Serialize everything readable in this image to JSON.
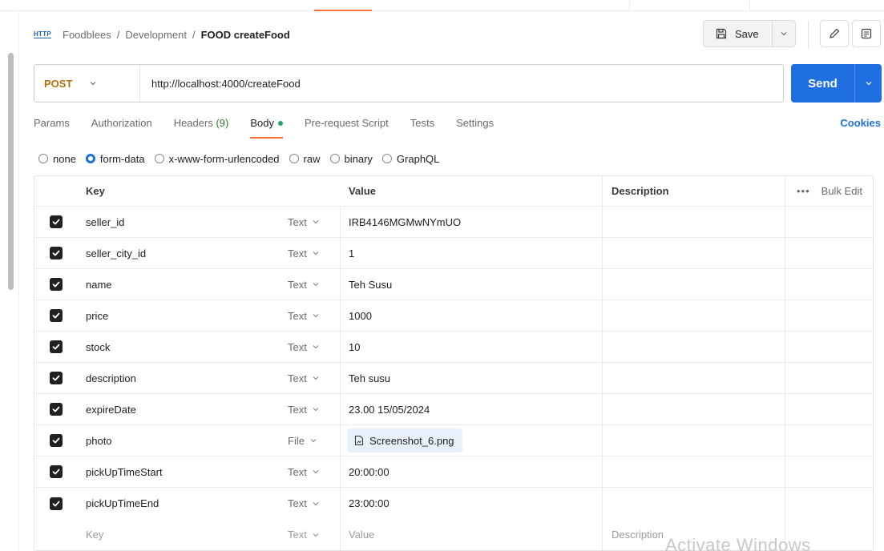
{
  "breadcrumb": {
    "icon": "http-icon",
    "icon_text": "HTTP",
    "items": [
      "Foodblees",
      "Development"
    ],
    "separator": "/",
    "current": "FOOD createFood"
  },
  "toolbar": {
    "save_label": "Save"
  },
  "request": {
    "method": "POST",
    "url": "http://localhost:4000/createFood",
    "send_label": "Send"
  },
  "tabs": [
    {
      "label": "Params"
    },
    {
      "label": "Authorization"
    },
    {
      "label": "Headers",
      "count": "(9)"
    },
    {
      "label": "Body",
      "active": true
    },
    {
      "label": "Pre-request Script"
    },
    {
      "label": "Tests"
    },
    {
      "label": "Settings"
    }
  ],
  "cookies_label": "Cookies",
  "body_types": [
    {
      "label": "none",
      "selected": false
    },
    {
      "label": "form-data",
      "selected": true
    },
    {
      "label": "x-www-form-urlencoded",
      "selected": false
    },
    {
      "label": "raw",
      "selected": false
    },
    {
      "label": "binary",
      "selected": false
    },
    {
      "label": "GraphQL",
      "selected": false
    }
  ],
  "table": {
    "headers": {
      "key": "Key",
      "value": "Value",
      "description": "Description",
      "bulk_edit": "Bulk Edit",
      "more": "•••"
    },
    "rows": [
      {
        "checked": true,
        "key": "seller_id",
        "type": "Text",
        "value": "IRB4146MGMwNYmUO"
      },
      {
        "checked": true,
        "key": "seller_city_id",
        "type": "Text",
        "value": "1"
      },
      {
        "checked": true,
        "key": "name",
        "type": "Text",
        "value": "Teh Susu"
      },
      {
        "checked": true,
        "key": "price",
        "type": "Text",
        "value": "1000"
      },
      {
        "checked": true,
        "key": "stock",
        "type": "Text",
        "value": "10"
      },
      {
        "checked": true,
        "key": "description",
        "type": "Text",
        "value": "Teh susu"
      },
      {
        "checked": true,
        "key": "expireDate",
        "type": "Text",
        "value": "23.00 15/05/2024"
      },
      {
        "checked": true,
        "key": "photo",
        "type": "File",
        "value": "Screenshot_6.png",
        "is_file": true
      },
      {
        "checked": true,
        "key": "pickUpTimeStart",
        "type": "Text",
        "value": "20:00:00"
      },
      {
        "checked": true,
        "key": "pickUpTimeEnd",
        "type": "Text",
        "value": "23:00:00"
      }
    ],
    "new_row": {
      "key_placeholder": "Key",
      "type": "Text",
      "value_placeholder": "Value",
      "description_placeholder": "Description"
    }
  },
  "watermark": "Activate Windows",
  "colors": {
    "accent": "#ff6c37",
    "send": "#1f6fe0",
    "method_post": "#b3700a",
    "body_dot": "#26a269"
  }
}
